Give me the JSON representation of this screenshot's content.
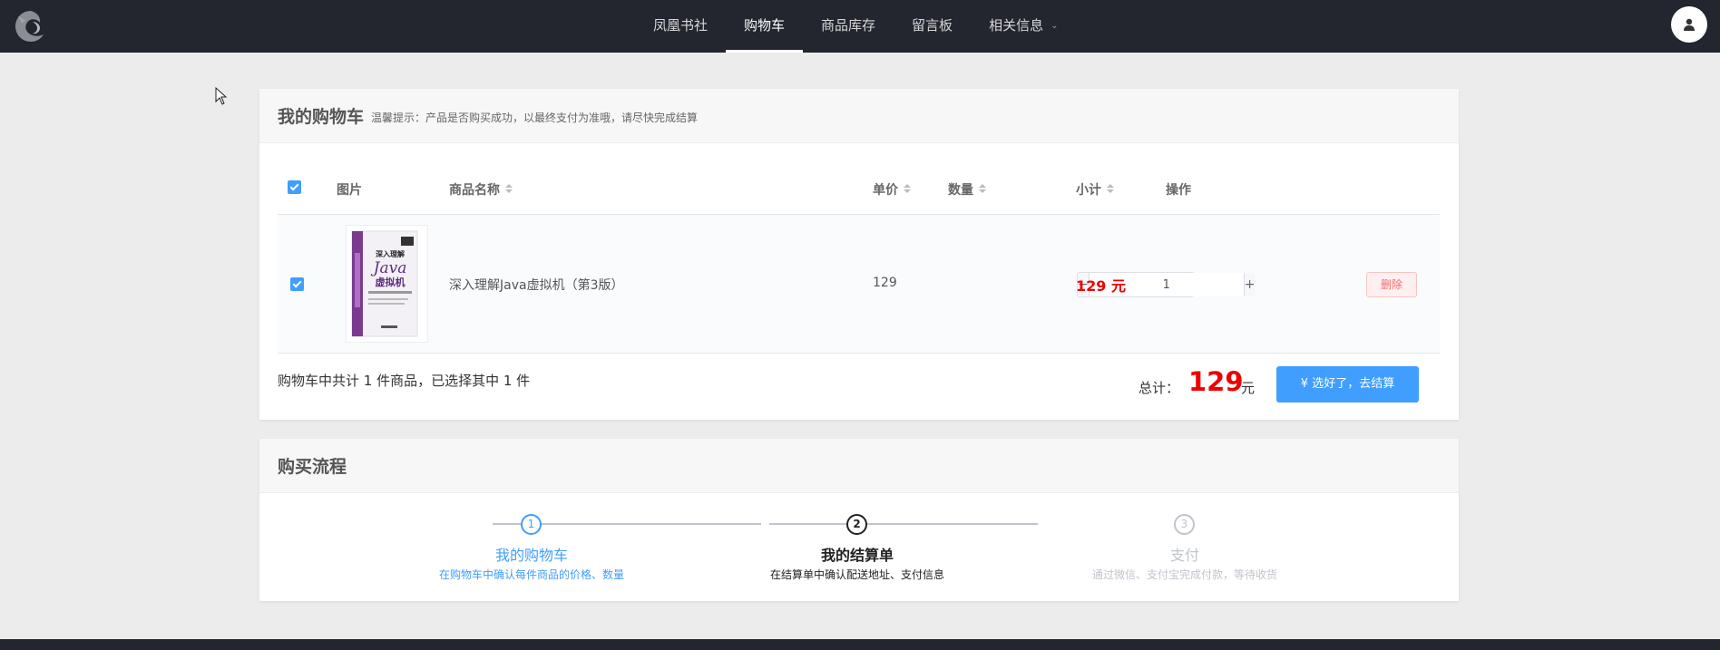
{
  "nav": {
    "items": [
      {
        "label": "凤凰书社"
      },
      {
        "label": "购物车",
        "active": true
      },
      {
        "label": "商品库存"
      },
      {
        "label": "留言板"
      },
      {
        "label": "相关信息",
        "has_dropdown": true
      }
    ],
    "logo_icon": "phoenix-logo-icon",
    "avatar_icon": "user-icon"
  },
  "cart": {
    "title": "我的购物车",
    "tip": "温馨提示：产品是否购买成功，以最终支付为准哦，请尽快完成结算",
    "columns": {
      "image": "图片",
      "name": "商品名称",
      "price": "单价",
      "qty": "数量",
      "subtotal": "小计",
      "action": "操作"
    },
    "items": [
      {
        "name": "深入理解Java虚拟机（第3版）",
        "price": "129",
        "qty": "1",
        "subtotal": "129 元",
        "delete_label": "删除",
        "cover": {
          "line1": "深入理解",
          "line2": "Java",
          "line3": "虚拟机"
        }
      }
    ],
    "summary": "购物车中共计 1 件商品，已选择其中 1 件",
    "total_label": "总计：",
    "total_value": "129",
    "total_unit": "元",
    "checkout_label": "¥ 选好了，去结算"
  },
  "flow": {
    "title": "购买流程",
    "steps": [
      {
        "num": "1",
        "title": "我的购物车",
        "desc": "在购物车中确认每件商品的价格、数量"
      },
      {
        "num": "2",
        "title": "我的结算单",
        "desc": "在结算单中确认配送地址、支付信息"
      },
      {
        "num": "3",
        "title": "支付",
        "desc": "通过微信、支付宝完成付款，等待收货"
      }
    ]
  },
  "colors": {
    "nav_bg": "#23262e",
    "accent": "#409eff",
    "price_red": "#ee0000",
    "page_bg": "#ececec"
  }
}
